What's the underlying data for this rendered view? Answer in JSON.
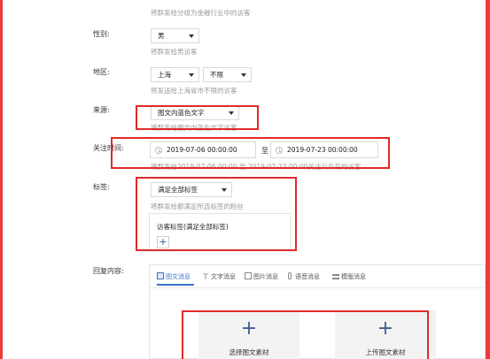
{
  "colors": {
    "frame": "#ee3a3a",
    "annotation_box": "#e02a2a",
    "accent": "#3b73c8",
    "plus": "#3d5f90"
  },
  "top_hint": "将群发给分组为金融行业中的访客",
  "gender": {
    "label": "性别:",
    "value": "男",
    "hint": "将群发给男访客"
  },
  "region": {
    "label": "地区:",
    "province": "上海",
    "city": "不限",
    "hint": "将发送给上海省市不限的访客"
  },
  "source": {
    "label": "来源:",
    "value": "图文内蓝色文字",
    "hint": "将群发给图文内蓝色文字访客"
  },
  "follow_time": {
    "label": "关注时间:",
    "start": "2019-07-06 00:00:00",
    "separator": "至",
    "end": "2019-07-23 00:00:00",
    "hint": "将群发给2019-07-06 00:00 至 2019-07-23 00:00关注公众号的访客"
  },
  "tags": {
    "label": "标签:",
    "value": "满足全部标签",
    "hint": "将群发给都满足所选标签的粉丝",
    "box_title": "访客标签(满足全部标签)",
    "add": "+"
  },
  "reply": {
    "label": "回复内容:",
    "tabs": [
      {
        "label": "图文消息",
        "icon": "news-icon"
      },
      {
        "label": "文字消息",
        "icon": "text-icon"
      },
      {
        "label": "图片消息",
        "icon": "image-icon"
      },
      {
        "label": "语音消息",
        "icon": "voice-icon"
      },
      {
        "label": "模版消息",
        "icon": "template-icon"
      }
    ],
    "select_material": "选择图文素材",
    "upload_material": "上传图文素材",
    "plus": "+"
  }
}
